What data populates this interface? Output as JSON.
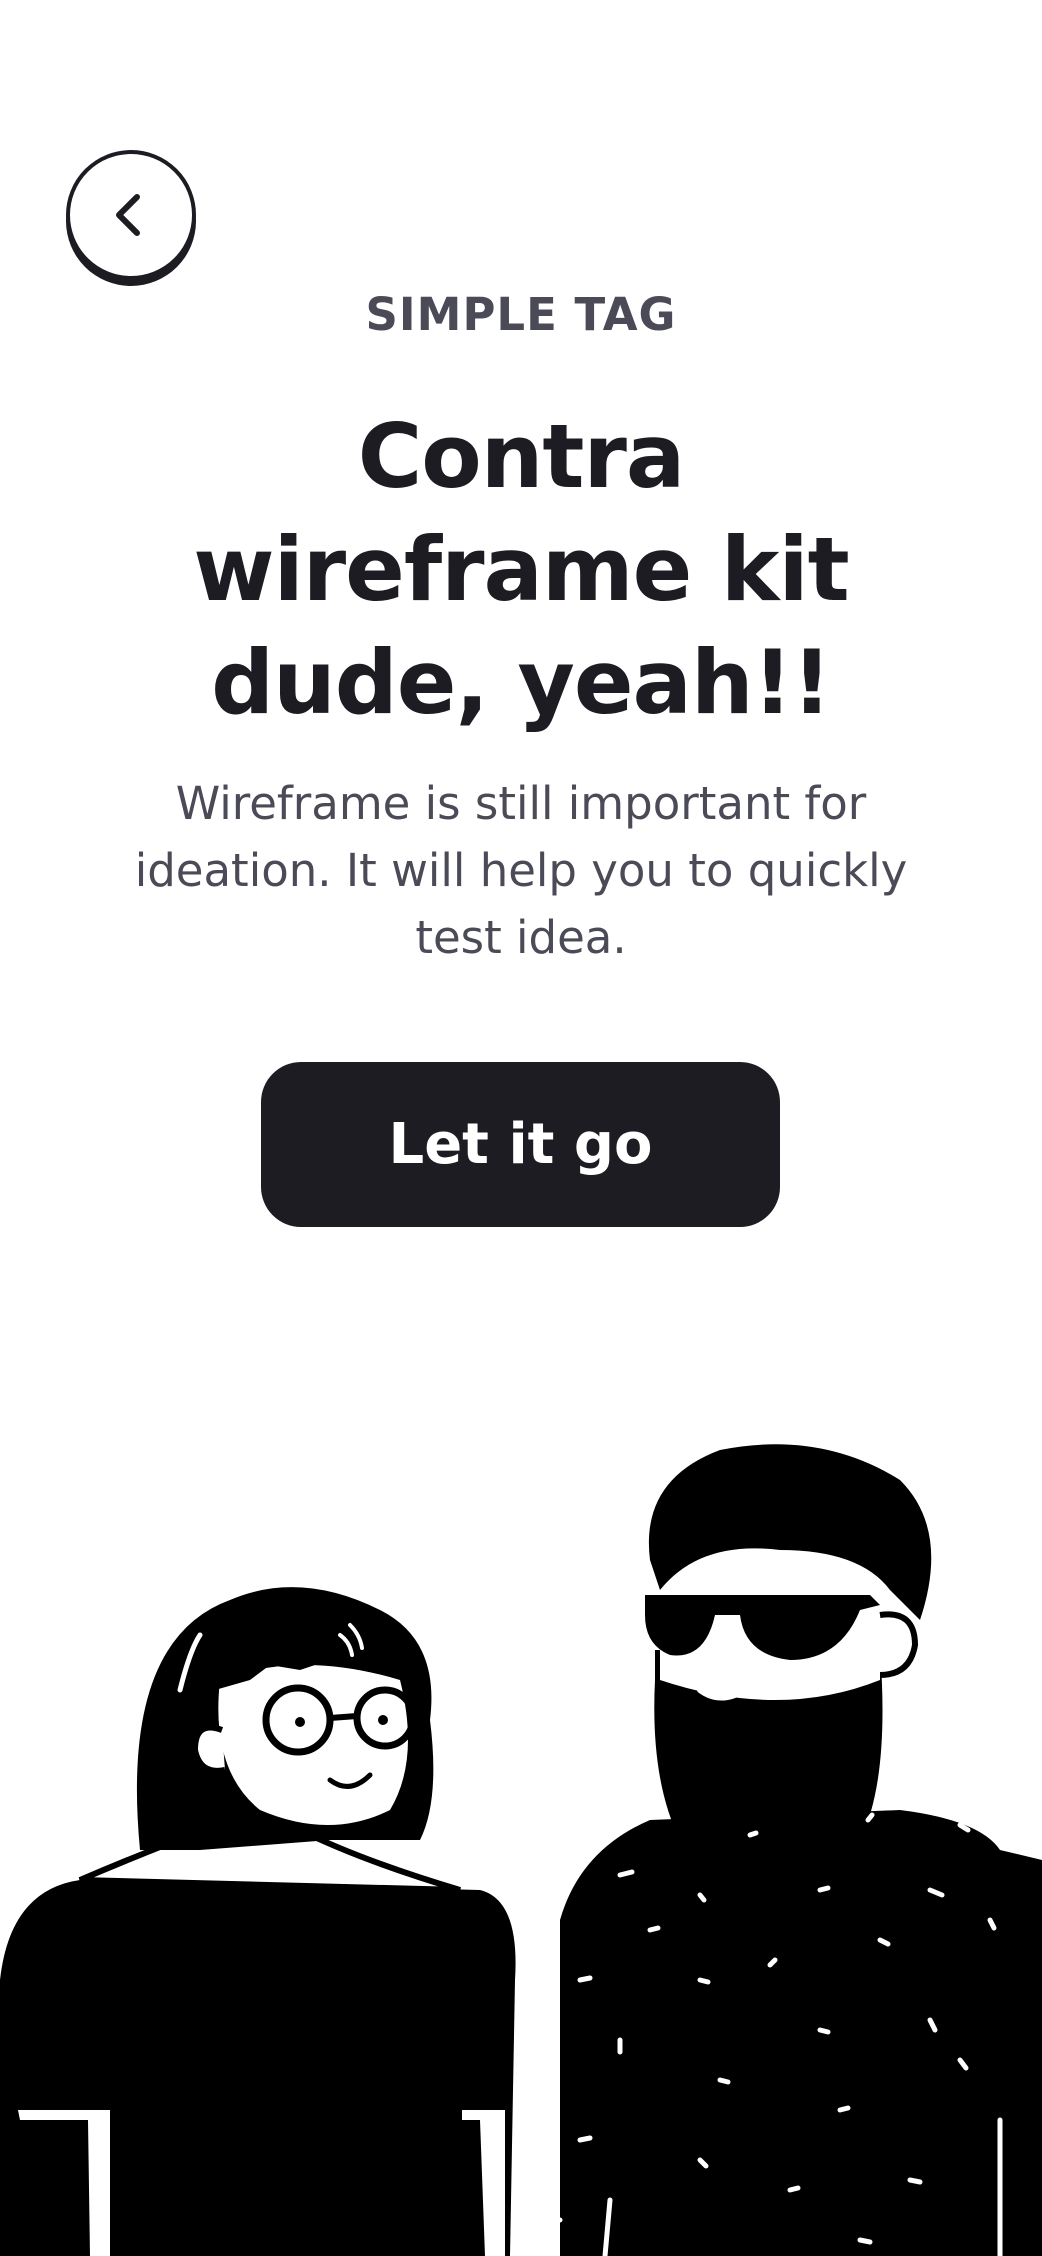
{
  "header": {
    "back_icon": "chevron-left-icon"
  },
  "hero": {
    "tag": "SIMPLE TAG",
    "headline_lines": [
      "Contra",
      "wireframe kit",
      "dude, yeah!!"
    ],
    "description": "Wireframe is still important for ideation. It will help you to quickly test idea.",
    "cta_label": "Let it go"
  },
  "illustration": {
    "subject": "two-people-illustration"
  },
  "colors": {
    "primary": "#1c1c22",
    "muted_text": "#4b4b58",
    "background": "#ffffff"
  }
}
